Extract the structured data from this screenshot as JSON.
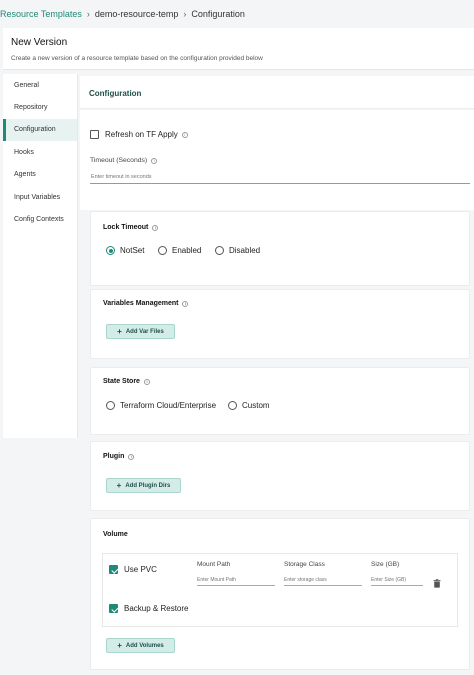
{
  "breadcrumb": {
    "root": "Resource Templates",
    "template": "demo-resource-temp",
    "current": "Configuration"
  },
  "header": {
    "title": "New Version",
    "subtitle": "Create a new version of a resource template based on the configuration provided below"
  },
  "sidebar": {
    "items": [
      {
        "label": "General"
      },
      {
        "label": "Repository"
      },
      {
        "label": "Configuration"
      },
      {
        "label": "Hooks"
      },
      {
        "label": "Agents"
      },
      {
        "label": "Input Variables"
      },
      {
        "label": "Config Contexts"
      }
    ],
    "active_index": 2
  },
  "configuration": {
    "title": "Configuration",
    "refresh_label": "Refresh on TF Apply",
    "refresh_checked": false,
    "timeout_label": "Timeout (Seconds)",
    "timeout_placeholder": "Enter timeout in seconds"
  },
  "lock_timeout": {
    "title": "Lock Timeout",
    "options": [
      "NotSet",
      "Enabled",
      "Disabled"
    ],
    "selected": "NotSet"
  },
  "variables_management": {
    "title": "Variables Management",
    "button": "Add Var Files"
  },
  "state_store": {
    "title": "State Store",
    "options": [
      "Terraform Cloud/Enterprise",
      "Custom"
    ],
    "selected": null
  },
  "plugin": {
    "title": "Plugin",
    "button": "Add Plugin Dirs"
  },
  "volume": {
    "title": "Volume",
    "use_pvc_label": "Use PVC",
    "use_pvc_checked": true,
    "backup_label": "Backup & Restore",
    "backup_checked": true,
    "mount_path_label": "Mount Path",
    "mount_path_placeholder": "Enter Mount Path",
    "storage_class_label": "Storage Class",
    "storage_class_placeholder": "Enter storage class",
    "size_label": "Size (GB)",
    "size_placeholder": "Enter Size (GB)",
    "button": "Add Volumes"
  },
  "colors": {
    "accent": "#1f8a78",
    "button_bg": "#d4ece8",
    "page_bg": "#f4f5f6"
  },
  "icons": [
    "info-icon",
    "plus-icon",
    "trash-icon",
    "checkbox-icon",
    "radio-icon"
  ]
}
